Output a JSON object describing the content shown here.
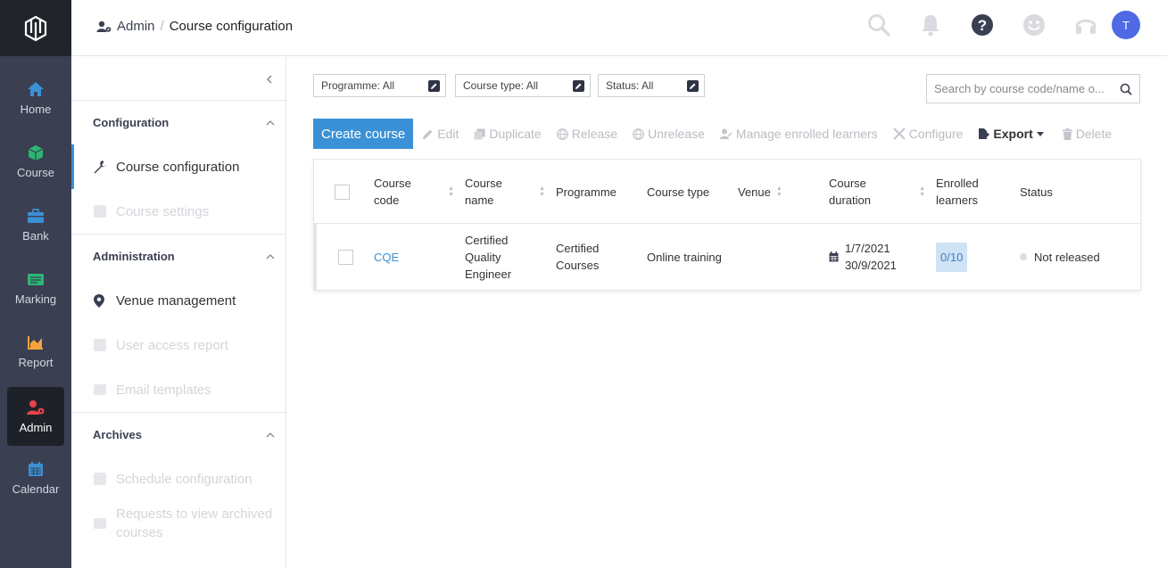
{
  "rail": {
    "items": [
      {
        "label": "Home",
        "icon": "home-icon",
        "color": "#3b91d6"
      },
      {
        "label": "Course",
        "icon": "cube-icon",
        "color": "#2bb673"
      },
      {
        "label": "Bank",
        "icon": "briefcase-icon",
        "color": "#3b91d6"
      },
      {
        "label": "Marking",
        "icon": "marking-icon",
        "color": "#2bb673"
      },
      {
        "label": "Report",
        "icon": "chart-icon",
        "color": "#f2a33a"
      },
      {
        "label": "Admin",
        "icon": "admin-icon",
        "color": "#e8434a",
        "active": true
      },
      {
        "label": "Calendar",
        "icon": "calendar-icon",
        "color": "#3b91d6"
      }
    ]
  },
  "header": {
    "breadcrumb_root": "Admin",
    "breadcrumb_current": "Course configuration",
    "avatar_initial": "T"
  },
  "subnav": {
    "sections": [
      {
        "title": "Configuration",
        "items": [
          {
            "label": "Course configuration",
            "state": "active"
          },
          {
            "label": "Course settings",
            "state": "disabled"
          }
        ]
      },
      {
        "title": "Administration",
        "items": [
          {
            "label": "Venue management",
            "state": "enabled"
          },
          {
            "label": "User access report",
            "state": "disabled"
          },
          {
            "label": "Email templates",
            "state": "disabled"
          }
        ]
      },
      {
        "title": "Archives",
        "items": [
          {
            "label": "Schedule configuration",
            "state": "disabled"
          },
          {
            "label": "Requests to view archived courses",
            "state": "disabled"
          }
        ]
      }
    ]
  },
  "filters": {
    "programme": "Programme: All",
    "course_type": "Course type: All",
    "status": "Status: All"
  },
  "search": {
    "placeholder": "Search by course code/name o..."
  },
  "toolbar": {
    "create": "Create course",
    "edit": "Edit",
    "duplicate": "Duplicate",
    "release": "Release",
    "unrelease": "Unrelease",
    "manage": "Manage enrolled learners",
    "configure": "Configure",
    "export": "Export",
    "delete": "Delete"
  },
  "table": {
    "headers": {
      "code_1": "Course",
      "code_2": "code",
      "name_1": "Course",
      "name_2": "name",
      "programme": "Programme",
      "type": "Course type",
      "venue": "Venue",
      "duration_1": "Course",
      "duration_2": "duration",
      "enrolled_1": "Enrolled",
      "enrolled_2": "learners",
      "status": "Status"
    },
    "rows": [
      {
        "code": "CQE",
        "name_1": "Certified",
        "name_2": "Quality",
        "name_3": "Engineer",
        "programme_1": "Certified",
        "programme_2": "Courses",
        "type": "Online training",
        "venue": "",
        "start": "1/7/2021",
        "end": "30/9/2021",
        "enrolled": "0/10",
        "status": "Not released"
      }
    ]
  }
}
